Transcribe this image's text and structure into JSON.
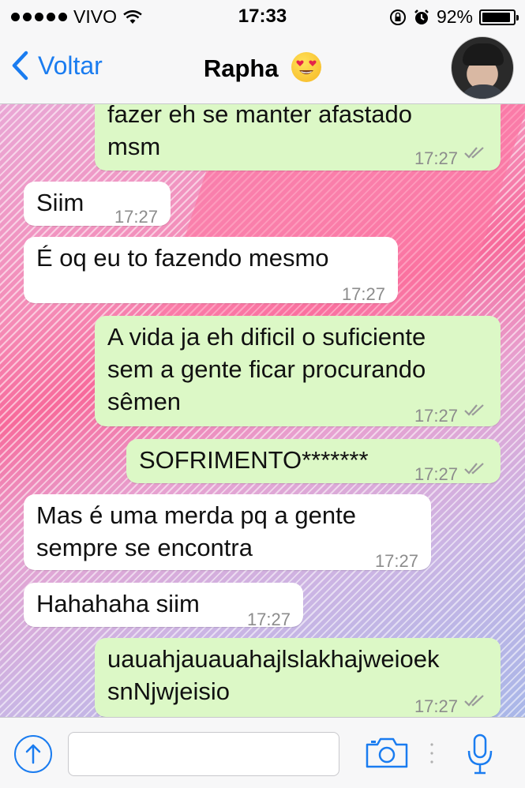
{
  "status_bar": {
    "carrier": "VIVO",
    "time": "17:33",
    "battery": "92%",
    "battery_level": 0.92
  },
  "nav": {
    "back_label": "Voltar",
    "contact_name": "Rapha",
    "emoji": "heart-eyes-emoji"
  },
  "messages": [
    {
      "direction": "out",
      "text": "fazer eh se manter afastado\nmsm",
      "time": "17:27",
      "status": "read"
    },
    {
      "direction": "in",
      "text": "Siim",
      "time": "17:27"
    },
    {
      "direction": "in",
      "text": "É oq eu to fazendo mesmo",
      "time": "17:27"
    },
    {
      "direction": "out",
      "text": "A vida ja eh dificil o suficiente\nsem a gente ficar procurando\nsêmen",
      "time": "17:27",
      "status": "read"
    },
    {
      "direction": "out",
      "text": "SOFRIMENTO*******",
      "time": "17:27",
      "status": "read"
    },
    {
      "direction": "in",
      "text": "Mas é uma merda pq a gente\nsempre se encontra",
      "time": "17:27"
    },
    {
      "direction": "in",
      "text": "Hahahaha siim",
      "time": "17:27"
    },
    {
      "direction": "out",
      "text": "uauahjauauahajlslakhajweioek\nsnNjwjeisio",
      "time": "17:27",
      "status": "read"
    }
  ],
  "input": {
    "placeholder": ""
  },
  "colors": {
    "accent": "#1a7cf0",
    "outgoing_bubble": "#dcf8c6",
    "incoming_bubble": "#ffffff"
  }
}
